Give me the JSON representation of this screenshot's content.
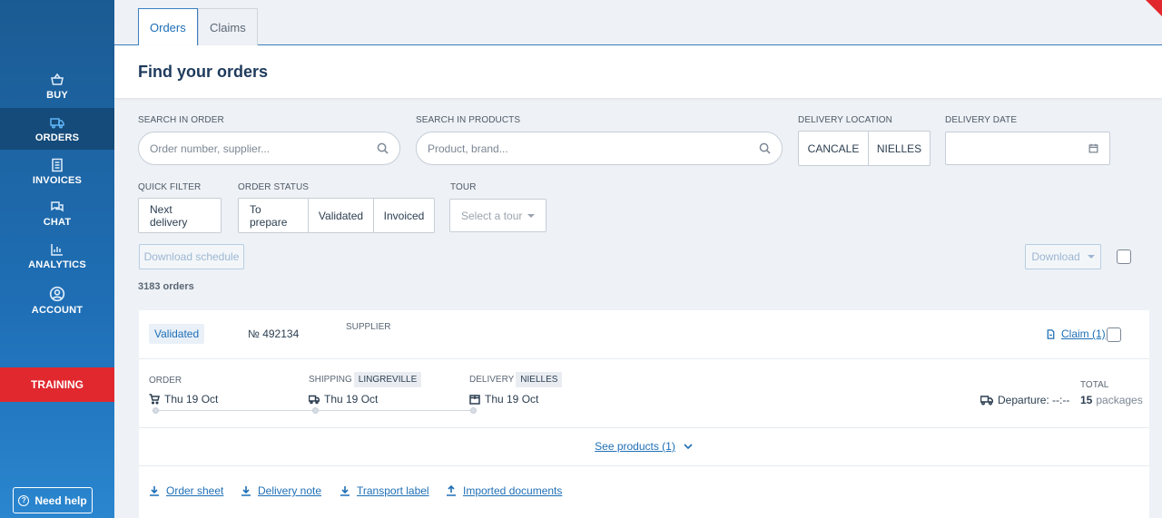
{
  "sidebar": {
    "items": [
      {
        "label": "BUY",
        "icon": "basket-icon"
      },
      {
        "label": "ORDERS",
        "icon": "truck-icon"
      },
      {
        "label": "INVOICES",
        "icon": "document-icon"
      },
      {
        "label": "CHAT",
        "icon": "chat-icon"
      },
      {
        "label": "ANALYTICS",
        "icon": "bar-chart-icon"
      },
      {
        "label": "ACCOUNT",
        "icon": "user-circle-icon"
      }
    ],
    "training_label": "TRAINING",
    "help_label": "Need help"
  },
  "tabs": {
    "orders": "Orders",
    "claims": "Claims"
  },
  "page_title": "Find your orders",
  "filters": {
    "search_order_label": "SEARCH IN ORDER",
    "search_order_placeholder": "Order number, supplier...",
    "search_products_label": "SEARCH IN PRODUCTS",
    "search_products_placeholder": "Product, brand...",
    "delivery_location_label": "DELIVERY LOCATION",
    "locations": [
      "CANCALE",
      "NIELLES"
    ],
    "delivery_date_label": "DELIVERY DATE",
    "quick_filter_label": "QUICK FILTER",
    "quick_filter_option": "Next delivery",
    "order_status_label": "ORDER STATUS",
    "statuses": [
      "To prepare",
      "Validated",
      "Invoiced"
    ],
    "tour_label": "TOUR",
    "tour_placeholder": "Select a tour"
  },
  "actions": {
    "download_schedule": "Download schedule",
    "download": "Download"
  },
  "order_count": "3183 orders",
  "order": {
    "status": "Validated",
    "number": "№ 492134",
    "supplier_label": "SUPPLIER",
    "claim_link": "Claim (1)",
    "order_label": "ORDER",
    "order_date": "Thu 19 Oct",
    "shipping_label": "SHIPPING",
    "shipping_location": "LINGREVILLE",
    "shipping_date": "Thu 19 Oct",
    "delivery_label": "DELIVERY",
    "delivery_location": "NIELLES",
    "delivery_date": "Thu 19 Oct",
    "departure": "Departure: --:--",
    "total_label": "TOTAL",
    "total_count": "15",
    "total_unit": "packages",
    "see_products": "See products (1)",
    "documents": [
      "Order sheet",
      "Delivery note",
      "Transport label",
      "Imported documents"
    ]
  },
  "colors": {
    "sidebar": "#1f6fb6",
    "accent": "#1f6fb6",
    "training": "#e0282e"
  }
}
